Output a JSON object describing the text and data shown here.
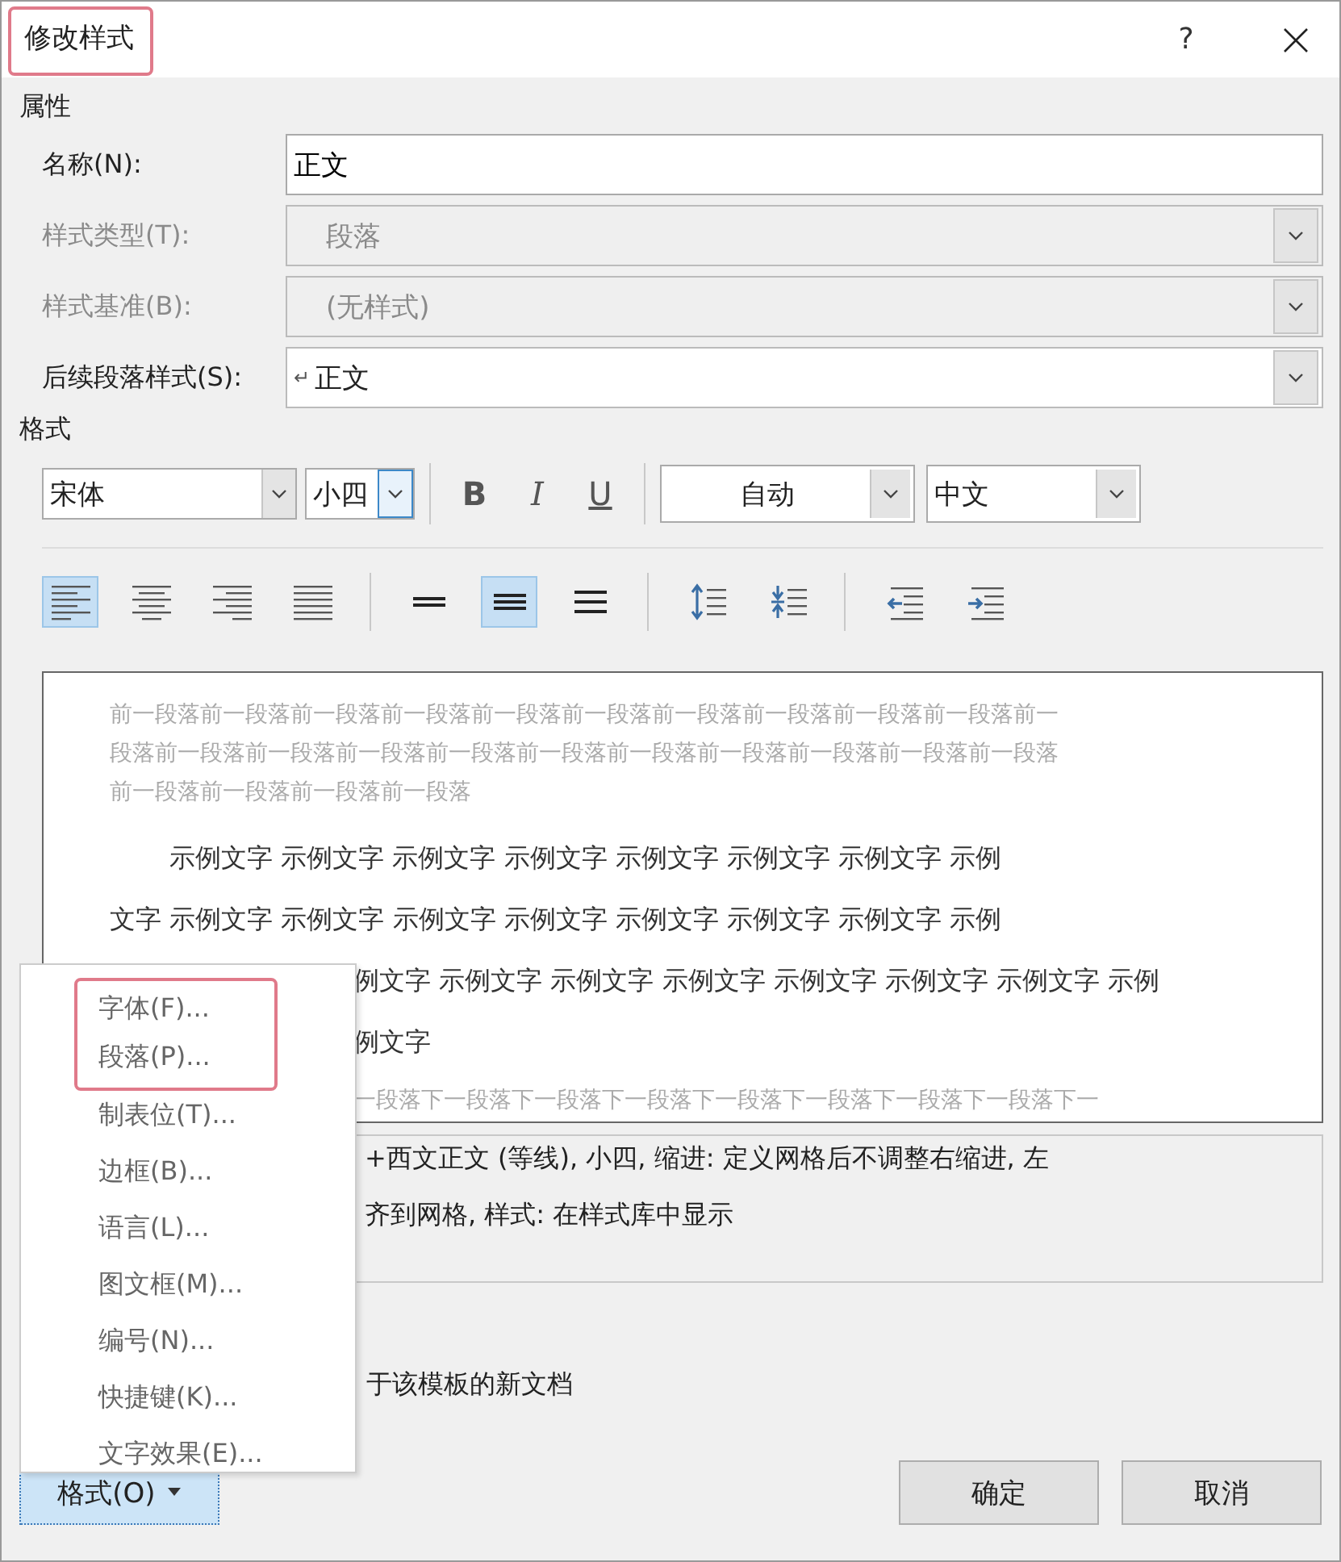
{
  "window": {
    "title": "修改样式",
    "title_marked": true,
    "help": "?"
  },
  "properties": {
    "heading": "属性",
    "fields": [
      {
        "label": "名称(N):",
        "value": "正文",
        "kind": "text",
        "disabled": false
      },
      {
        "label": "样式类型(T):",
        "value": "段落",
        "kind": "dropdown",
        "disabled": true
      },
      {
        "label": "样式基准(B):",
        "value": "(无样式)",
        "kind": "dropdown",
        "disabled": true
      },
      {
        "label": "后续段落样式(S):",
        "value": "正文",
        "mark": "↵",
        "kind": "dropdown",
        "disabled": false
      }
    ]
  },
  "format": {
    "heading": "格式",
    "font": "宋体",
    "size": "小四",
    "size_focused": true,
    "bold": "B",
    "italic": "I",
    "underline": "U",
    "text_color": "自动",
    "script": "中文",
    "align_buttons": [
      {
        "kind": "left",
        "selected": true
      },
      {
        "kind": "center",
        "selected": false
      },
      {
        "kind": "right",
        "selected": false
      },
      {
        "kind": "justify",
        "selected": false
      }
    ],
    "spacing_buttons": [
      {
        "kind": "single",
        "selected": false
      },
      {
        "kind": "one-half",
        "selected": true
      },
      {
        "kind": "double",
        "selected": false
      }
    ]
  },
  "preview": {
    "previous_lines": [
      "前一段落前一段落前一段落前一段落前一段落前一段落前一段落前一段落前一段落前一段落前一",
      "段落前一段落前一段落前一段落前一段落前一段落前一段落前一段落前一段落前一段落前一段落",
      "前一段落前一段落前一段落前一段落"
    ],
    "sample_lines": [
      {
        "kind": "first",
        "text": "示例文字 示例文字 示例文字 示例文字 示例文字 示例文字 示例文字 示例"
      },
      {
        "kind": "full",
        "text": "文字 示例文字 示例文字 示例文字 示例文字 示例文字 示例文字 示例文字 示例"
      },
      {
        "kind": "partial",
        "text": "例文字 示例文字 示例文字 示例文字 示例文字 示例文字 示例文字 示例"
      },
      {
        "kind": "partial",
        "text": "例文字"
      }
    ],
    "next_lines": [
      "一段落下一段落下一段落下一段落下一段落下一段落下一段落下一段落下一"
    ]
  },
  "description": [
    "+西文正文 (等线), 小四, 缩进: 定义网格后不调整右缩进, 左",
    "齐到网格, 样式: 在样式库中显示"
  ],
  "template_option": "于该模板的新文档",
  "menu": {
    "items": [
      {
        "label": "字体(F)...",
        "marked": true
      },
      {
        "label": "段落(P)...",
        "marked": true
      },
      {
        "label": "制表位(T)...",
        "marked": false
      },
      {
        "label": "边框(B)...",
        "marked": false
      },
      {
        "label": "语言(L)...",
        "marked": false
      },
      {
        "label": "图文框(M)...",
        "marked": false
      },
      {
        "label": "编号(N)...",
        "marked": false
      },
      {
        "label": "快捷键(K)...",
        "marked": false
      },
      {
        "label": "文字效果(E)...",
        "marked": false
      }
    ]
  },
  "format_button": "格式(O)",
  "buttons": [
    "确定",
    "取消"
  ]
}
